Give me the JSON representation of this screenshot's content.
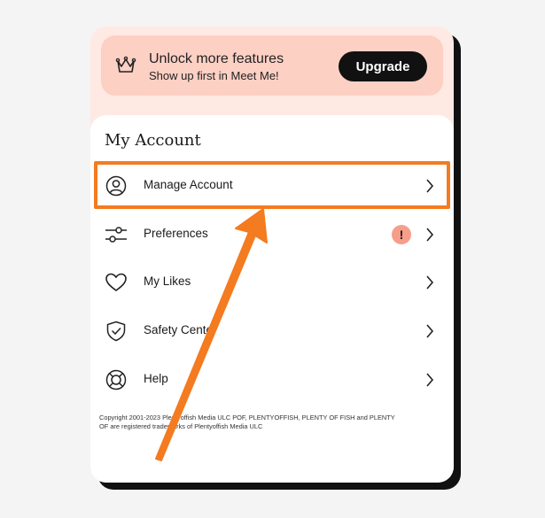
{
  "promo": {
    "title": "Unlock more features",
    "subtitle": "Show up first in Meet Me!",
    "button_label": "Upgrade",
    "icon": "crown-icon"
  },
  "account": {
    "title": "My Account",
    "items": [
      {
        "label": "Manage Account",
        "icon": "user-circle-icon",
        "badge": ""
      },
      {
        "label": "Preferences",
        "icon": "sliders-icon",
        "badge": "!"
      },
      {
        "label": "My Likes",
        "icon": "heart-icon",
        "badge": ""
      },
      {
        "label": "Safety Cente",
        "icon": "shield-check-icon",
        "badge": ""
      },
      {
        "label": "Help",
        "icon": "lifebuoy-icon",
        "badge": ""
      }
    ]
  },
  "copyright": "Copyright 2001-2023 Plentyoffish Media ULC POF, PLENTYOFFISH, PLENTY OF FISH and PLENTY OF are registered trademarks of Plentyoffish Media ULC",
  "colors": {
    "promo_bg": "#fdd0c4",
    "highlight": "#f47b20",
    "badge": "#f79e8a",
    "button": "#111111"
  }
}
